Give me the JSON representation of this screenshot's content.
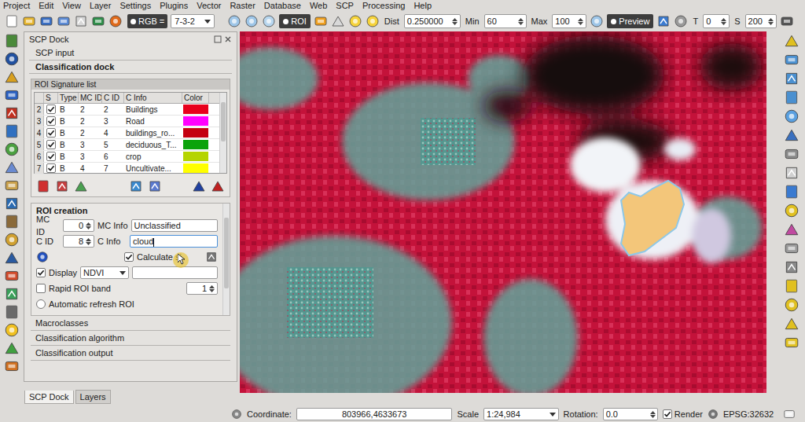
{
  "menu": [
    "Project",
    "Edit",
    "View",
    "Layer",
    "Settings",
    "Plugins",
    "Vector",
    "Raster",
    "Database",
    "Web",
    "SCP",
    "Processing",
    "Help"
  ],
  "toolbar": {
    "rgb_label": "RGB",
    "rgb_sign": "=",
    "band_set": "7-3-2",
    "roi_button": "ROI",
    "dist_label": "Dist",
    "dist": "0.250000",
    "min_label": "Min",
    "min": "60",
    "max_label": "Max",
    "max": "100",
    "preview": "Preview",
    "t_label": "T",
    "t": "0",
    "s_label": "S",
    "s": "200"
  },
  "dock": {
    "title": "SCP Dock",
    "sections": [
      {
        "label": "SCP input",
        "bold": false
      },
      {
        "label": "Classification dock",
        "bold": true
      }
    ],
    "signature_list": {
      "title": "ROI Signature list",
      "columns": [
        "S",
        "Type",
        "MC ID",
        "C ID",
        "C Info",
        "Color"
      ],
      "rows": [
        {
          "num": "2",
          "checked": true,
          "type": "B",
          "mc_id": "2",
          "c_id": "2",
          "info": "Buildings",
          "color": "#e8001c"
        },
        {
          "num": "3",
          "checked": true,
          "type": "B",
          "mc_id": "2",
          "c_id": "3",
          "info": "Road",
          "color": "#ff00ff"
        },
        {
          "num": "4",
          "checked": true,
          "type": "B",
          "mc_id": "2",
          "c_id": "4",
          "info": "buildings_ro...",
          "color": "#c40010"
        },
        {
          "num": "5",
          "checked": true,
          "type": "B",
          "mc_id": "3",
          "c_id": "5",
          "info": "deciduous_T...",
          "color": "#0ca30c"
        },
        {
          "num": "6",
          "checked": true,
          "type": "B",
          "mc_id": "3",
          "c_id": "6",
          "info": "crop",
          "color": "#b5d400"
        },
        {
          "num": "7",
          "checked": true,
          "type": "B",
          "mc_id": "4",
          "c_id": "7",
          "info": "Uncultivate...",
          "color": "#ffff00"
        }
      ]
    },
    "roi_creation": {
      "title": "ROI creation",
      "mc_id_label": "MC ID",
      "mc_id": "0",
      "mc_info_label": "MC Info",
      "mc_info": "Unclassified",
      "c_id_label": "C ID",
      "c_id": "8",
      "c_info_label": "C Info",
      "c_info": "cloud",
      "calculate_sig": {
        "label": "Calculate si",
        "checked": true
      },
      "display": {
        "label": "Display",
        "checked": true,
        "value": "NDVI"
      },
      "rapid_roi_band": {
        "label": "Rapid ROI band",
        "checked": false,
        "value": "1"
      },
      "automatic_refresh": {
        "label": "Automatic refresh ROI",
        "selected": false
      }
    },
    "collapsed_sections": [
      "Macroclasses",
      "Classification algorithm",
      "Classification output"
    ]
  },
  "dock_tabs": [
    {
      "label": "SCP Dock",
      "selected": true
    },
    {
      "label": "Layers",
      "selected": false
    }
  ],
  "status_bar": {
    "coordinate_label": "Coordinate:",
    "coordinate": "803966,4633673",
    "scale_label": "Scale",
    "scale": "1:24,984",
    "rotation_label": "Rotation:",
    "rotation": "0.0",
    "render": {
      "label": "Render",
      "checked": true
    },
    "crs": "EPSG:32632"
  }
}
